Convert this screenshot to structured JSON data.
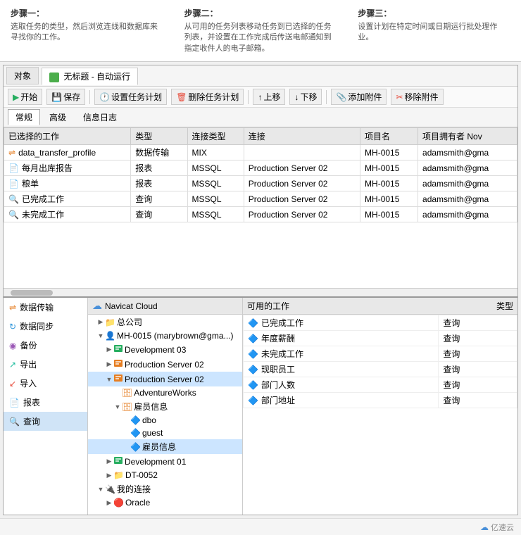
{
  "steps": {
    "step1": {
      "title": "步骤一：",
      "desc": "选取任务的类型，然后浏览连线和数据库来寻找你的工作。"
    },
    "step2": {
      "title": "步骤二：",
      "desc": "从可用的任务列表移动任务到已选择的任务列表，并设置在工作完成后传送电邮通知到指定收件人的电子邮箱。"
    },
    "step3": {
      "title": "步骤三：",
      "desc": "设置计划在特定时间或日期运行批处理作业。"
    }
  },
  "tabs": {
    "obj_tab": "对象",
    "auto_tab": "无标题 - 自动运行"
  },
  "toolbar": {
    "start": "开始",
    "save": "保存",
    "set_schedule": "设置任务计划",
    "del_schedule": "删除任务计划",
    "move_up": "上移",
    "move_down": "下移",
    "add_attach": "添加附件",
    "remove_attach": "移除附件"
  },
  "inner_tabs": [
    "常规",
    "高级",
    "信息日志"
  ],
  "table": {
    "headers": [
      "已选择的工作",
      "类型",
      "连接类型",
      "连接",
      "项目名",
      "项目拥有者 Nov"
    ],
    "rows": [
      {
        "name": "data_transfer_profile",
        "type": "数据传输",
        "conn_type": "MIX",
        "conn": "",
        "project": "MH-0015",
        "owner": "adamsmith@gma"
      },
      {
        "name": "每月出库报告",
        "type": "报表",
        "conn_type": "MSSQL",
        "conn": "Production Server 02",
        "project": "MH-0015",
        "owner": "adamsmith@gma"
      },
      {
        "name": "粮单",
        "type": "报表",
        "conn_type": "MSSQL",
        "conn": "Production Server 02",
        "project": "MH-0015",
        "owner": "adamsmith@gma"
      },
      {
        "name": "已完成工作",
        "type": "查询",
        "conn_type": "MSSQL",
        "conn": "Production Server 02",
        "project": "MH-0015",
        "owner": "adamsmith@gma"
      },
      {
        "name": "未完成工作",
        "type": "查询",
        "conn_type": "MSSQL",
        "conn": "Production Server 02",
        "project": "MH-0015",
        "owner": "adamsmith@gma"
      }
    ]
  },
  "left_nav": {
    "items": [
      {
        "label": "数据传输",
        "icon": "transfer"
      },
      {
        "label": "数据同步",
        "icon": "sync"
      },
      {
        "label": "备份",
        "icon": "backup"
      },
      {
        "label": "导出",
        "icon": "export"
      },
      {
        "label": "导入",
        "icon": "import"
      },
      {
        "label": "报表",
        "icon": "report"
      },
      {
        "label": "查询",
        "icon": "query"
      }
    ]
  },
  "tree": {
    "header": "Navicat Cloud",
    "items": [
      {
        "label": "总公司",
        "level": 1,
        "icon": "folder",
        "expanded": true
      },
      {
        "label": "MH-0015 (marybrown@gma...)",
        "level": 1,
        "icon": "user",
        "expanded": true
      },
      {
        "label": "Development 03",
        "level": 2,
        "icon": "server-dev"
      },
      {
        "label": "Production Server 02",
        "level": 2,
        "icon": "server-prod"
      },
      {
        "label": "Production Server 02",
        "level": 2,
        "icon": "server-prod2",
        "expanded": true,
        "selected": true
      },
      {
        "label": "AdventureWorks",
        "level": 3,
        "icon": "db"
      },
      {
        "label": "雇员信息",
        "level": 3,
        "icon": "db-expanded",
        "expanded": true
      },
      {
        "label": "dbo",
        "level": 4,
        "icon": "schema"
      },
      {
        "label": "guest",
        "level": 4,
        "icon": "schema"
      },
      {
        "label": "雇员信息",
        "level": 4,
        "icon": "table",
        "selected": true
      },
      {
        "label": "Development 01",
        "level": 2,
        "icon": "server-dev2"
      },
      {
        "label": "DT-0052",
        "level": 2,
        "icon": "folder2"
      },
      {
        "label": "我的连接",
        "level": 1,
        "icon": "conn",
        "expanded": true
      },
      {
        "label": "Oracle",
        "level": 2,
        "icon": "oracle"
      }
    ]
  },
  "available_panel": {
    "headers": [
      "可用的工作",
      "类型"
    ],
    "rows": [
      {
        "name": "已完成工作",
        "type": "查询"
      },
      {
        "name": "年度薪酬",
        "type": "查询"
      },
      {
        "name": "未完成工作",
        "type": "查询"
      },
      {
        "name": "现职员工",
        "type": "查询"
      },
      {
        "name": "部门人数",
        "type": "查询"
      },
      {
        "name": "部门地址",
        "type": "查询"
      }
    ]
  },
  "branding": "亿速云"
}
